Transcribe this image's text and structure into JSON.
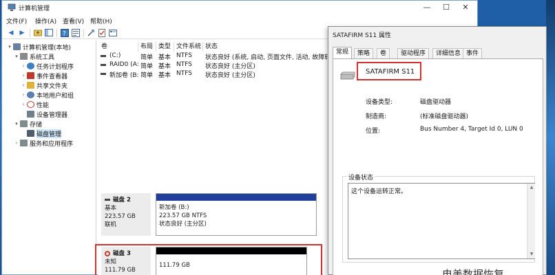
{
  "window": {
    "title": "计算机管理",
    "min": "—",
    "max": "☐",
    "close": "✕"
  },
  "menu": [
    "文件(F)",
    "操作(A)",
    "查看(V)",
    "帮助(H)"
  ],
  "tree": [
    {
      "label": "计算机管理(本地)",
      "icon": "computer-icon",
      "color": "#6b7fa3"
    },
    {
      "label": "系统工具",
      "icon": "tools-icon",
      "color": "#8a8a8a"
    },
    {
      "label": "任务计划程序",
      "icon": "clock-icon",
      "color": "#3f7fc2"
    },
    {
      "label": "事件查看器",
      "icon": "event-viewer-icon",
      "color": "#c0392b"
    },
    {
      "label": "共享文件夹",
      "icon": "shared-folder-icon",
      "color": "#e0b23a"
    },
    {
      "label": "本地用户和组",
      "icon": "users-icon",
      "color": "#5a7fb0"
    },
    {
      "label": "性能",
      "icon": "performance-icon",
      "color": "#c0392b"
    },
    {
      "label": "设备管理器",
      "icon": "device-manager-icon",
      "color": "#6e7f8d"
    },
    {
      "label": "存储",
      "icon": "storage-icon",
      "color": "#7f8c8d"
    },
    {
      "label": "磁盘管理",
      "icon": "disk-management-icon",
      "color": "#4d5d6c"
    },
    {
      "label": "服务和应用程序",
      "icon": "services-icon",
      "color": "#7f8c8d"
    }
  ],
  "volume_table": {
    "headers": [
      "卷",
      "布局",
      "类型",
      "文件系统",
      "状态"
    ],
    "rows": [
      [
        "(C:)",
        "简单",
        "基本",
        "NTFS",
        "状态良好 (系统, 启动, 页面文件, 活动, 故障转储, 主分区)"
      ],
      [
        "RAID0 (A:)",
        "简单",
        "基本",
        "NTFS",
        "状态良好 (主分区)"
      ],
      [
        "新加卷 (B:)",
        "简单",
        "基本",
        "NTFS",
        "状态良好 (主分区)"
      ]
    ]
  },
  "disks": [
    {
      "name": "磁盘 2",
      "type": "基本",
      "size": "223.57 GB",
      "status": "联机",
      "partition_name": "新加卷  (B:)",
      "partition_size": "223.57 GB NTFS",
      "partition_status": "状态良好 (主分区)",
      "bar_color": "#1f3f99"
    },
    {
      "name": "磁盘 3",
      "type": "未知",
      "size": "111.79 GB",
      "partition_size": "111.79 GB",
      "bar_color": "#000000"
    }
  ],
  "dialog": {
    "title": "SATAFIRM   S11 属性",
    "tabs": [
      "常规",
      "策略",
      "卷",
      "驱动程序",
      "详细信息",
      "事件"
    ],
    "device_name": "SATAFIRM   S11",
    "fields": [
      {
        "label": "设备类型:",
        "value": "磁盘驱动器"
      },
      {
        "label": "制造商:",
        "value": "(标准磁盘驱动器)"
      },
      {
        "label": "位置:",
        "value": "Bus Number 4, Target Id 0, LUN 0"
      }
    ],
    "status_legend": "设备状态",
    "status_text": "这个设备运转正常。",
    "watermark": "电美数据恢复"
  },
  "colors": {
    "highlight": "#d32f2f",
    "selection": "#cce4f7",
    "desktop": "#1f5fa8"
  }
}
